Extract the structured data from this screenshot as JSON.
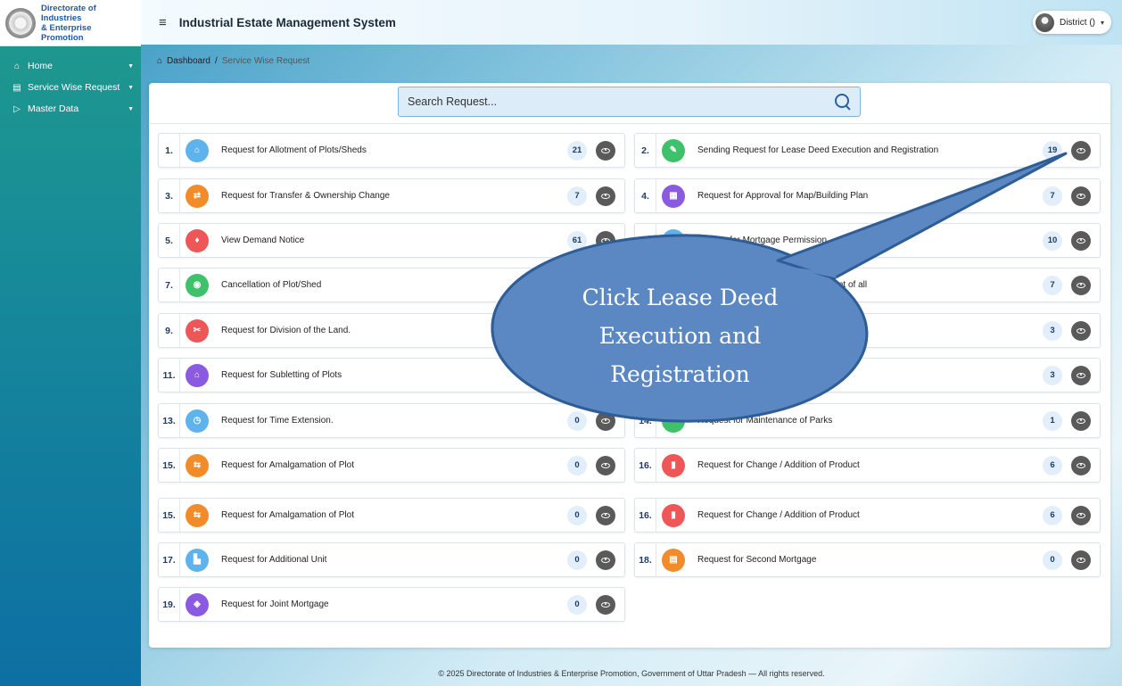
{
  "brand": {
    "line1": "Directorate of Industries",
    "line2": "& Enterprise Promotion"
  },
  "sidebar": {
    "items": [
      {
        "label": "Home",
        "icon": "home-icon"
      },
      {
        "label": "Service Wise Request",
        "icon": "list-icon"
      },
      {
        "label": "Master Data",
        "icon": "database-icon"
      }
    ]
  },
  "header": {
    "title": "Industrial Estate Management System",
    "user": "District ()"
  },
  "breadcrumb": {
    "root": "Dashboard",
    "separator": "/",
    "current": "Service Wise Request"
  },
  "search": {
    "placeholder": "Search Request..."
  },
  "services": [
    {
      "num": "1.",
      "label": "Request for Allotment of Plots/Sheds",
      "count": "21",
      "color": "#5fb3ec",
      "glyph": "⌂"
    },
    {
      "num": "2.",
      "label": "Sending Request for Lease Deed Execution and Registration",
      "count": "19",
      "color": "#3fc06a",
      "glyph": "✎"
    },
    {
      "num": "3.",
      "label": "Request for Transfer & Ownership Change",
      "count": "7",
      "color": "#f28c2a",
      "glyph": "⇄"
    },
    {
      "num": "4.",
      "label": "Request for Approval for Map/Building Plan",
      "count": "7",
      "color": "#8a5ae0",
      "glyph": "▦"
    },
    {
      "num": "5.",
      "label": "View Demand Notice",
      "count": "61",
      "color": "#ee5757",
      "glyph": "♦"
    },
    {
      "num": "6.",
      "label": "Service for Mortgage Permission",
      "count": "10",
      "color": "#5fb3ec",
      "glyph": "●"
    },
    {
      "num": "7.",
      "label": "Cancellation of Plot/Shed",
      "count": "",
      "color": "#3fc06a",
      "glyph": "◉"
    },
    {
      "num": "8.",
      "label": "cate by the department after payment of all",
      "count": "7",
      "color": "#f28c2a",
      "glyph": "●"
    },
    {
      "num": "9.",
      "label": "Request for Division of the Land.",
      "count": "",
      "color": "#ee5757",
      "glyph": "✂"
    },
    {
      "num": "10.",
      "label": "",
      "count": "3",
      "color": "#8a5ae0",
      "glyph": "●"
    },
    {
      "num": "11.",
      "label": "Request for Subletting of Plots",
      "count": "",
      "color": "#8a5ae0",
      "glyph": "⌂"
    },
    {
      "num": "12.",
      "label": "",
      "count": "3",
      "color": "#5fb3ec",
      "glyph": "●"
    },
    {
      "num": "13.",
      "label": "Request for Time Extension.",
      "count": "0",
      "color": "#5fb3ec",
      "glyph": "◷"
    },
    {
      "num": "14.",
      "label": "Request for Maintenance of Parks",
      "count": "1",
      "color": "#3fc06a",
      "glyph": "●"
    },
    {
      "num": "15.",
      "label": "Request for Amalgamation of Plot",
      "count": "0",
      "color": "#f28c2a",
      "glyph": "⇆"
    },
    {
      "num": "16.",
      "label": "Request for Change / Addition of Product",
      "count": "6",
      "color": "#ee5757",
      "glyph": "▮"
    },
    {
      "num": "15.",
      "label": "Request for Amalgamation of Plot",
      "count": "0",
      "color": "#f28c2a",
      "glyph": "⇆"
    },
    {
      "num": "16.",
      "label": "Request for Change / Addition of Product",
      "count": "6",
      "color": "#ee5757",
      "glyph": "▮"
    },
    {
      "num": "17.",
      "label": "Request for Additional Unit",
      "count": "0",
      "color": "#5fb3ec",
      "glyph": "▙"
    },
    {
      "num": "18.",
      "label": "Request for Second Mortgage",
      "count": "0",
      "color": "#f28c2a",
      "glyph": "▤"
    },
    {
      "num": "19.",
      "label": "Request for Joint Mortgage",
      "count": "0",
      "color": "#8a5ae0",
      "glyph": "◈"
    }
  ],
  "callout": {
    "line1": "Click Lease Deed",
    "line2": "Execution and",
    "line3": "Registration"
  },
  "footer": {
    "text": "© 2025 Directorate of Industries & Enterprise Promotion, Government of Uttar Pradesh — All rights reserved."
  }
}
